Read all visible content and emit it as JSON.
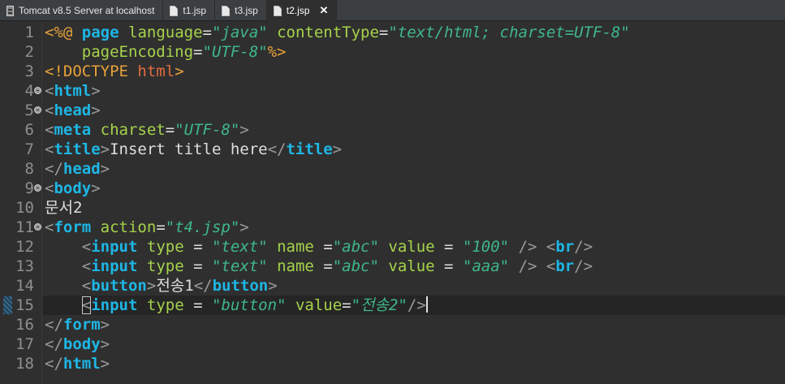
{
  "tabs": [
    {
      "label": "Tomcat v8.5 Server at localhost",
      "icon": "server-icon",
      "active": false
    },
    {
      "label": "t1.jsp",
      "icon": "jsp-file-icon",
      "active": false
    },
    {
      "label": "t3.jsp",
      "icon": "jsp-file-icon",
      "active": false
    },
    {
      "label": "t2.jsp",
      "icon": "jsp-file-icon",
      "active": true,
      "close": "✕"
    }
  ],
  "editor": {
    "current_line": 15,
    "colors": {
      "background": "#2f2f2f",
      "tag": "#1eb6e5",
      "attribute": "#a6d34b",
      "value": "#3fb88a",
      "directive": "#e8a23a",
      "bracket": "#9a9a9a",
      "text": "#dedede"
    },
    "lines": [
      {
        "n": "1",
        "tokens": [
          [
            "kr",
            "<%@"
          ],
          [
            "t",
            " "
          ],
          [
            "k",
            "page"
          ],
          [
            "t",
            " "
          ],
          [
            "a",
            "language"
          ],
          [
            "t",
            "="
          ],
          [
            "v",
            "\"java\""
          ],
          [
            "t",
            " "
          ],
          [
            "a",
            "contentType"
          ],
          [
            "t",
            "="
          ],
          [
            "v",
            "\"text/html; charset=UTF-8\""
          ]
        ]
      },
      {
        "n": "2",
        "tokens": [
          [
            "t",
            "    "
          ],
          [
            "a",
            "pageEncoding"
          ],
          [
            "t",
            "="
          ],
          [
            "v",
            "\"UTF-8\""
          ],
          [
            "kr",
            "%>"
          ]
        ]
      },
      {
        "n": "3",
        "tokens": [
          [
            "kr",
            "<!"
          ],
          [
            "kr",
            "DOCTYPE"
          ],
          [
            "t",
            " "
          ],
          [
            "pe",
            "html"
          ],
          [
            "kr",
            ">"
          ]
        ]
      },
      {
        "n": "4",
        "fold": true,
        "tokens": [
          [
            "p",
            "<"
          ],
          [
            "k",
            "html"
          ],
          [
            "p",
            ">"
          ]
        ]
      },
      {
        "n": "5",
        "fold": true,
        "tokens": [
          [
            "p",
            "<"
          ],
          [
            "k",
            "head"
          ],
          [
            "p",
            ">"
          ]
        ]
      },
      {
        "n": "6",
        "tokens": [
          [
            "p",
            "<"
          ],
          [
            "k",
            "meta"
          ],
          [
            "t",
            " "
          ],
          [
            "a",
            "charset"
          ],
          [
            "t",
            "="
          ],
          [
            "v",
            "\"UTF-8\""
          ],
          [
            "p",
            ">"
          ]
        ]
      },
      {
        "n": "7",
        "tokens": [
          [
            "p",
            "<"
          ],
          [
            "k",
            "title"
          ],
          [
            "p",
            ">"
          ],
          [
            "t",
            "Insert title here"
          ],
          [
            "p",
            "</"
          ],
          [
            "k",
            "title"
          ],
          [
            "p",
            ">"
          ]
        ]
      },
      {
        "n": "8",
        "tokens": [
          [
            "p",
            "</"
          ],
          [
            "k",
            "head"
          ],
          [
            "p",
            ">"
          ]
        ]
      },
      {
        "n": "9",
        "fold": true,
        "tokens": [
          [
            "p",
            "<"
          ],
          [
            "k",
            "body"
          ],
          [
            "p",
            ">"
          ]
        ]
      },
      {
        "n": "10",
        "tokens": [
          [
            "t",
            "문서2"
          ]
        ]
      },
      {
        "n": "11",
        "fold": true,
        "tokens": [
          [
            "p",
            "<"
          ],
          [
            "k",
            "form"
          ],
          [
            "t",
            " "
          ],
          [
            "a",
            "action"
          ],
          [
            "t",
            "="
          ],
          [
            "v",
            "\"t4.jsp\""
          ],
          [
            "p",
            ">"
          ]
        ]
      },
      {
        "n": "12",
        "tokens": [
          [
            "t",
            "    "
          ],
          [
            "p",
            "<"
          ],
          [
            "k",
            "input"
          ],
          [
            "t",
            " "
          ],
          [
            "a",
            "type"
          ],
          [
            "t",
            " = "
          ],
          [
            "v",
            "\"text\""
          ],
          [
            "t",
            " "
          ],
          [
            "a",
            "name"
          ],
          [
            "t",
            " ="
          ],
          [
            "v",
            "\"abc\""
          ],
          [
            "t",
            " "
          ],
          [
            "a",
            "value"
          ],
          [
            "t",
            " = "
          ],
          [
            "v",
            "\"100\""
          ],
          [
            "t",
            " "
          ],
          [
            "p",
            "/>"
          ],
          [
            "t",
            " "
          ],
          [
            "p",
            "<"
          ],
          [
            "k",
            "br"
          ],
          [
            "p",
            "/>"
          ]
        ]
      },
      {
        "n": "13",
        "tokens": [
          [
            "t",
            "    "
          ],
          [
            "p",
            "<"
          ],
          [
            "k",
            "input"
          ],
          [
            "t",
            " "
          ],
          [
            "a",
            "type"
          ],
          [
            "t",
            " = "
          ],
          [
            "v",
            "\"text\""
          ],
          [
            "t",
            " "
          ],
          [
            "a",
            "name"
          ],
          [
            "t",
            " ="
          ],
          [
            "v",
            "\"abc\""
          ],
          [
            "t",
            " "
          ],
          [
            "a",
            "value"
          ],
          [
            "t",
            " = "
          ],
          [
            "v",
            "\"aaa\""
          ],
          [
            "t",
            " "
          ],
          [
            "p",
            "/>"
          ],
          [
            "t",
            " "
          ],
          [
            "p",
            "<"
          ],
          [
            "k",
            "br"
          ],
          [
            "p",
            "/>"
          ]
        ]
      },
      {
        "n": "14",
        "tokens": [
          [
            "t",
            "    "
          ],
          [
            "p",
            "<"
          ],
          [
            "k",
            "button"
          ],
          [
            "p",
            ">"
          ],
          [
            "t",
            "전송1"
          ],
          [
            "p",
            "</"
          ],
          [
            "k",
            "button"
          ],
          [
            "p",
            ">"
          ]
        ]
      },
      {
        "n": "15",
        "marker": true,
        "tokens": [
          [
            "t",
            "    "
          ],
          [
            "pbox",
            "<"
          ],
          [
            "k",
            "input"
          ],
          [
            "t",
            " "
          ],
          [
            "a",
            "type"
          ],
          [
            "t",
            " = "
          ],
          [
            "v",
            "\"button\""
          ],
          [
            "t",
            " "
          ],
          [
            "a",
            "value"
          ],
          [
            "t",
            "="
          ],
          [
            "v",
            "\"전송2\""
          ],
          [
            "p",
            "/>"
          ],
          [
            "caret",
            ""
          ]
        ]
      },
      {
        "n": "16",
        "tokens": [
          [
            "p",
            "</"
          ],
          [
            "k",
            "form"
          ],
          [
            "p",
            ">"
          ]
        ]
      },
      {
        "n": "17",
        "tokens": [
          [
            "p",
            "</"
          ],
          [
            "k",
            "body"
          ],
          [
            "p",
            ">"
          ]
        ]
      },
      {
        "n": "18",
        "tokens": [
          [
            "p",
            "</"
          ],
          [
            "k",
            "html"
          ],
          [
            "p",
            ">"
          ]
        ]
      }
    ]
  }
}
